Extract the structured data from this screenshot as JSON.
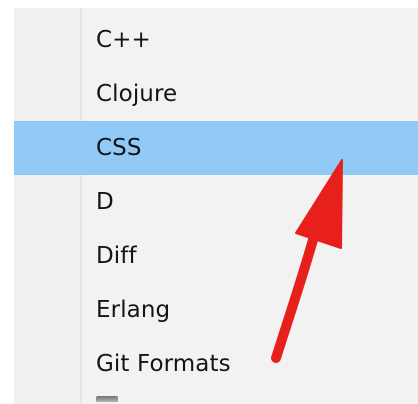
{
  "menu": {
    "items": [
      {
        "label": "C++",
        "selected": false
      },
      {
        "label": "Clojure",
        "selected": false
      },
      {
        "label": "CSS",
        "selected": true
      },
      {
        "label": "D",
        "selected": false
      },
      {
        "label": "Diff",
        "selected": false
      },
      {
        "label": "Erlang",
        "selected": false
      },
      {
        "label": "Git Formats",
        "selected": false
      }
    ]
  },
  "colors": {
    "selection": "#91c9f7",
    "menu_background": "#f2f2f2",
    "annotation_arrow": "#e8201c"
  },
  "annotation": {
    "icon": "red-arrow-icon",
    "points_to": "CSS"
  }
}
